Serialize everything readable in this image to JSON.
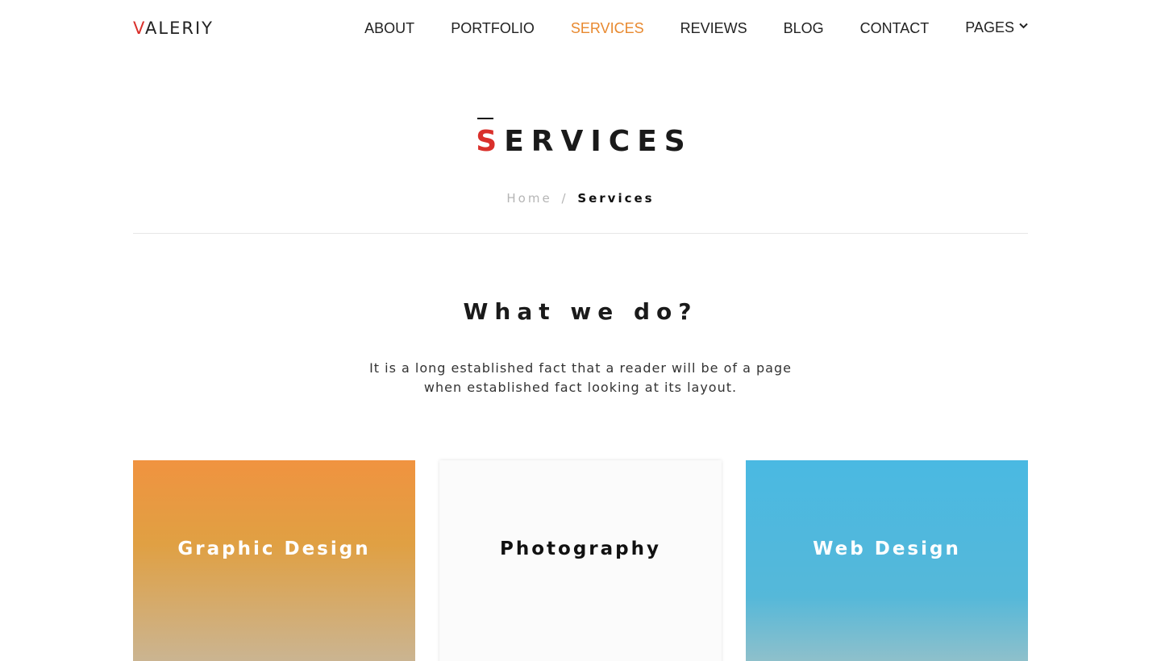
{
  "header": {
    "logo_first": "V",
    "logo_rest": "ALERIY",
    "nav": [
      {
        "label": "ABOUT"
      },
      {
        "label": "PORTFOLIO"
      },
      {
        "label": "SERVICES"
      },
      {
        "label": "REVIEWS"
      },
      {
        "label": "BLOG"
      },
      {
        "label": "CONTACT"
      },
      {
        "label": "PAGES"
      }
    ],
    "active_nav": "SERVICES",
    "dropdown_icon": "chevron-down-icon"
  },
  "hero": {
    "title_first": "S",
    "title_rest": "ERVICES",
    "breadcrumb": {
      "home": "Home",
      "separator": "/",
      "current": "Services"
    }
  },
  "section": {
    "title": "What we do?",
    "desc_line1": "It is a long established fact that a reader will be of a page",
    "desc_line2": "when established fact looking at its layout."
  },
  "cards": [
    {
      "label": "Graphic Design"
    },
    {
      "label": "Photography"
    },
    {
      "label": "Web Design"
    }
  ],
  "colors": {
    "accent_red": "#d9302b",
    "accent_orange": "#e8892f",
    "card_blue": "#4ab9e2"
  }
}
